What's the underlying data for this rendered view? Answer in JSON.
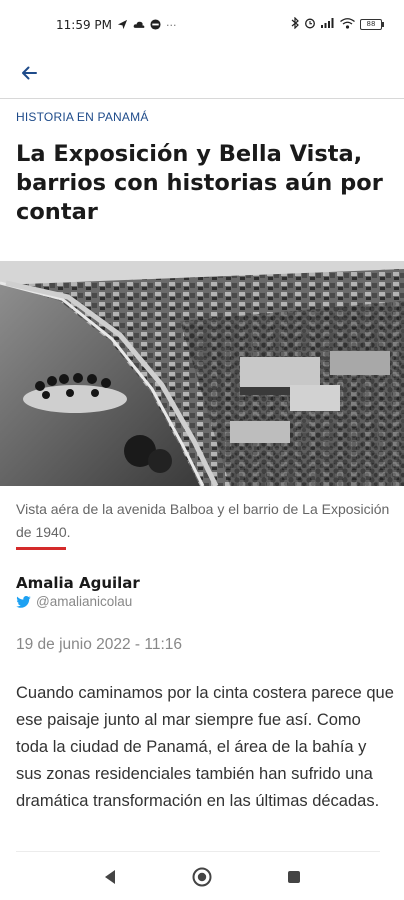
{
  "status_bar": {
    "time": "11:59 PM",
    "left_icons": [
      "navigation-icon",
      "cloud-icon",
      "app-notification-icon",
      "more-dots-icon"
    ],
    "right_icons": [
      "bluetooth-icon",
      "alarm-icon",
      "signal-icon",
      "wifi-icon",
      "battery-icon"
    ],
    "battery_level": "88"
  },
  "header": {
    "back_icon": "arrow-left-icon",
    "accent_color": "#1e4b8a"
  },
  "article": {
    "kicker": "HISTORIA EN PANAMÁ",
    "headline": "La Exposición y Bella Vista, barrios con historias aún por contar",
    "image_caption": "Vista aéra de la avenida Balboa y el barrio de La Exposición de 1940.",
    "accent_rule_color": "#d42a2a",
    "author": {
      "name": "Amalia Aguilar",
      "twitter_handle": "@amalianicolau",
      "twitter_color": "#1da1f2"
    },
    "date": "19 de junio 2022 - 11:16",
    "body": "Cuando caminamos por la cinta costera parece que ese paisaje junto al mar siempre fue así. Como toda la ciudad de Panamá, el área de la bahía y sus zonas residenciales también han sufrido una dramática transformación en las últimas décadas."
  },
  "navigation": {
    "buttons": [
      "back-triangle-icon",
      "home-circle-icon",
      "recents-square-icon"
    ]
  }
}
